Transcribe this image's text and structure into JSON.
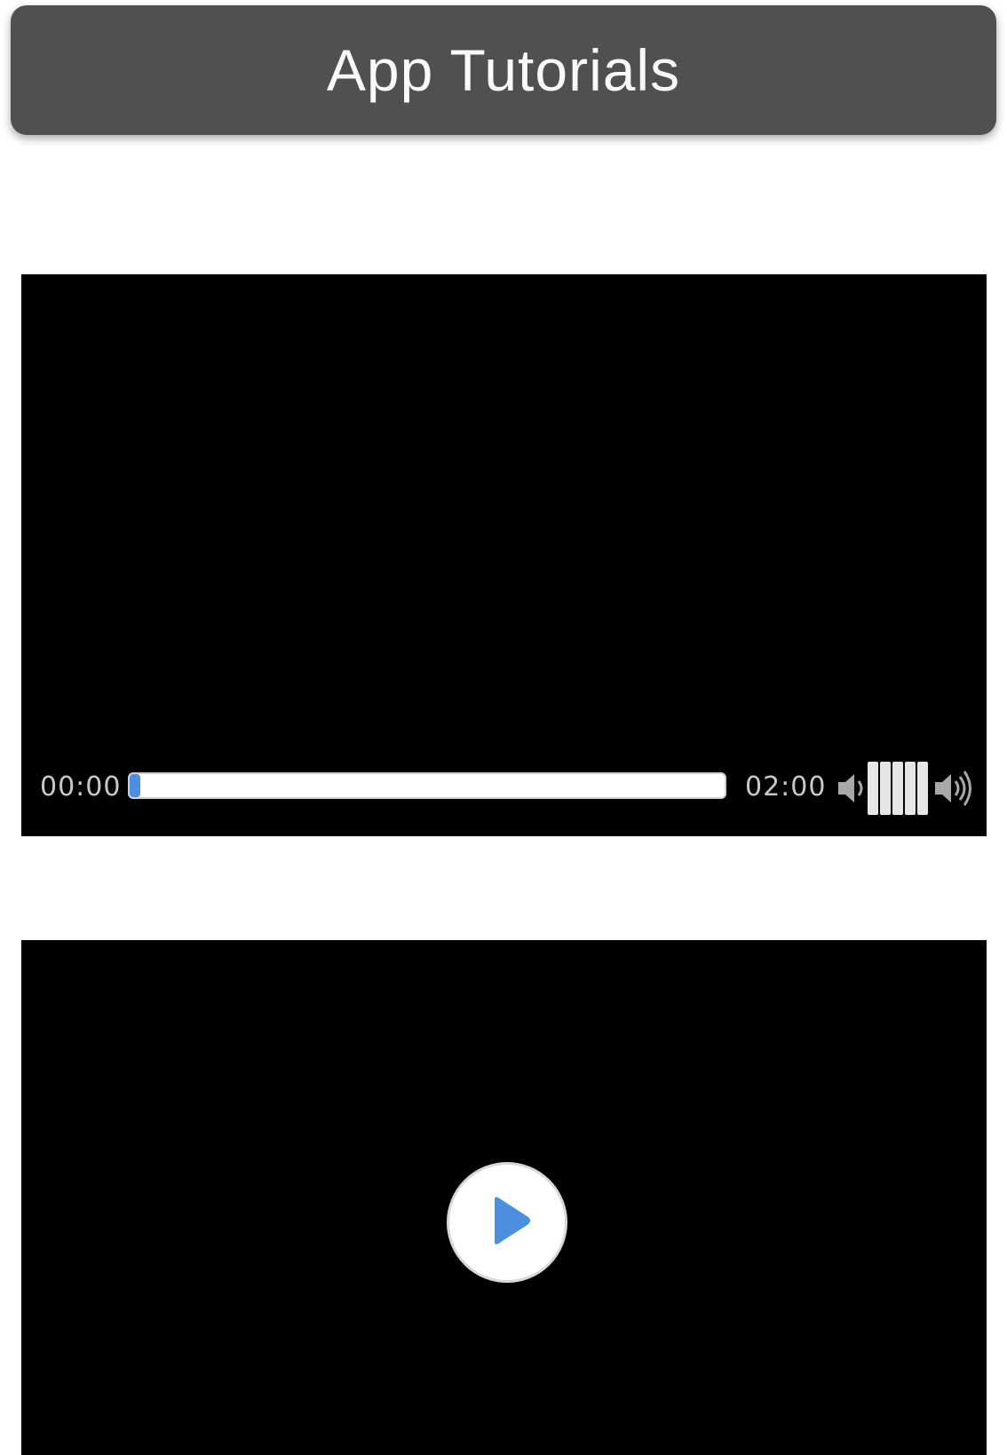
{
  "header": {
    "title": "App Tutorials"
  },
  "videos": [
    {
      "state": "playing",
      "controls": {
        "current_time": "00:00",
        "total_time": "02:00",
        "progress_fraction": 0.0,
        "volume_level": 5,
        "volume_max": 5
      }
    },
    {
      "state": "paused",
      "play_icon": "play-icon"
    }
  ],
  "colors": {
    "header_bg": "#505050",
    "accent": "#4a8fe0",
    "video_bg": "#000000"
  },
  "icons": {
    "volume_low": "volume-low-icon",
    "volume_high": "volume-high-icon",
    "play": "play-icon"
  }
}
